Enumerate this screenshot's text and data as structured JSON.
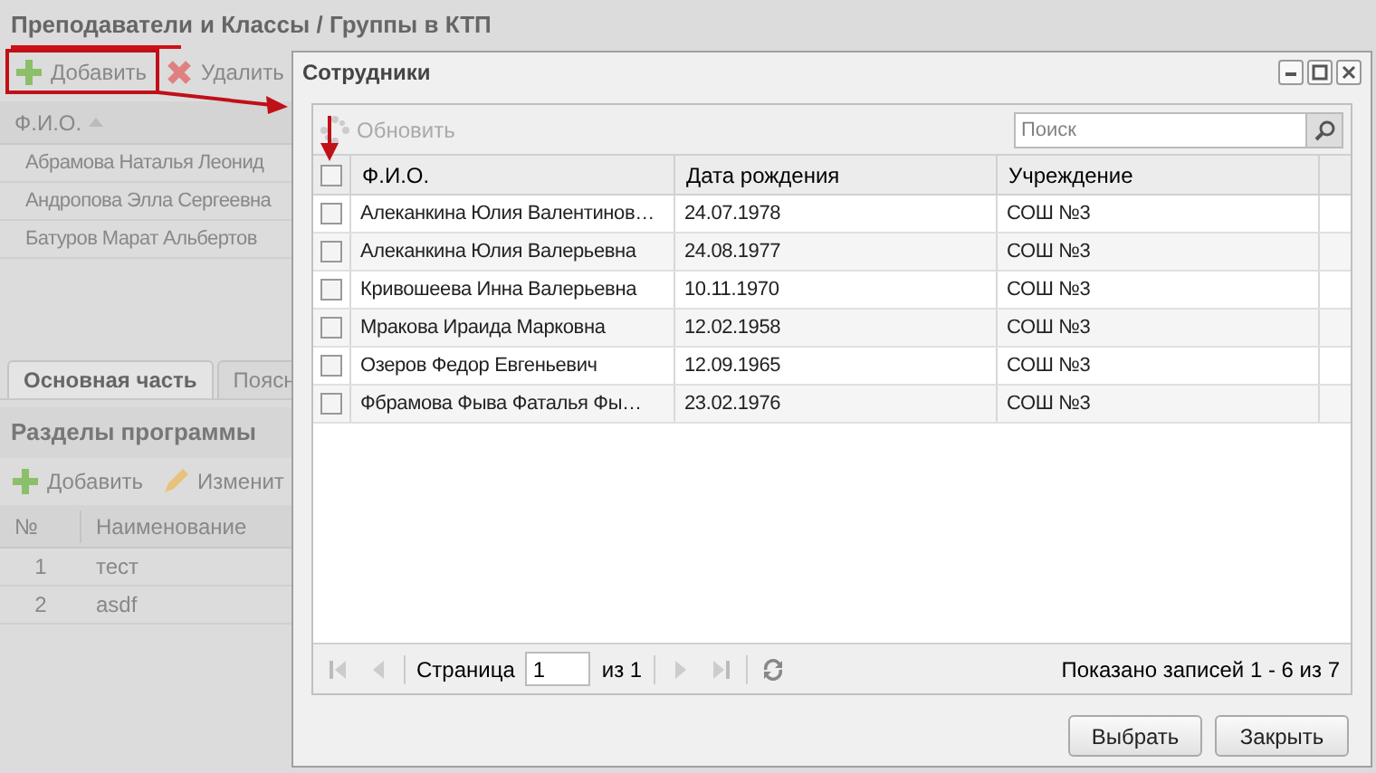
{
  "breadcrumb": {
    "items": [
      "Преподаватели",
      "и Классы / Группы в КТП"
    ]
  },
  "toolbar": [
    "Добавить",
    "Удалить"
  ],
  "teachers": {
    "column": "Ф.И.О.",
    "rows": [
      "Абрамова Наталья Леонид",
      "Андропова Элла Сергеевна",
      "Батуров Марат Альбертов"
    ]
  },
  "tabs": [
    {
      "label": "Основная часть",
      "selected": true
    },
    {
      "label": "Поясн",
      "selected": false
    }
  ],
  "sections": {
    "title": "Разделы программы",
    "toolbar": [
      "Добавить",
      "Изменит"
    ],
    "columns": [
      "№",
      "Наименование"
    ],
    "rows": [
      [
        "1",
        "тест"
      ],
      [
        "2",
        "asdf"
      ]
    ]
  },
  "dialog": {
    "title": "Сотрудники",
    "refresh": "Обновить",
    "search": {
      "placeholder": "Поиск"
    },
    "columns": [
      "Ф.И.О.",
      "Дата рождения",
      "Учреждение"
    ],
    "header_checked": false,
    "rows": [
      {
        "name": "Алеканкина Юлия Валентинов…",
        "date": "24.07.1978",
        "org": "СОШ №3",
        "checked": false
      },
      {
        "name": "Алеканкина Юлия Валерьевна",
        "date": "24.08.1977",
        "org": "СОШ №3",
        "checked": false
      },
      {
        "name": "Кривошеева Инна Валерьевна",
        "date": "10.11.1970",
        "org": "СОШ №3",
        "checked": false
      },
      {
        "name": "Мракова Ираида Марковна",
        "date": "12.02.1958",
        "org": "СОШ №3",
        "checked": false
      },
      {
        "name": "Озеров Федор Евгеньевич",
        "date": "12.09.1965",
        "org": "СОШ №3",
        "checked": false
      },
      {
        "name": "Фбрамова Фыва Фаталья Фы…",
        "date": "23.02.1976",
        "org": "СОШ №3",
        "checked": false
      }
    ],
    "paging": {
      "page_label": "Страница",
      "page": "1",
      "of": "из 1",
      "summary": "Показано записей 1 - 6 из 7"
    },
    "buttons": [
      "Выбрать",
      "Закрыть"
    ]
  }
}
